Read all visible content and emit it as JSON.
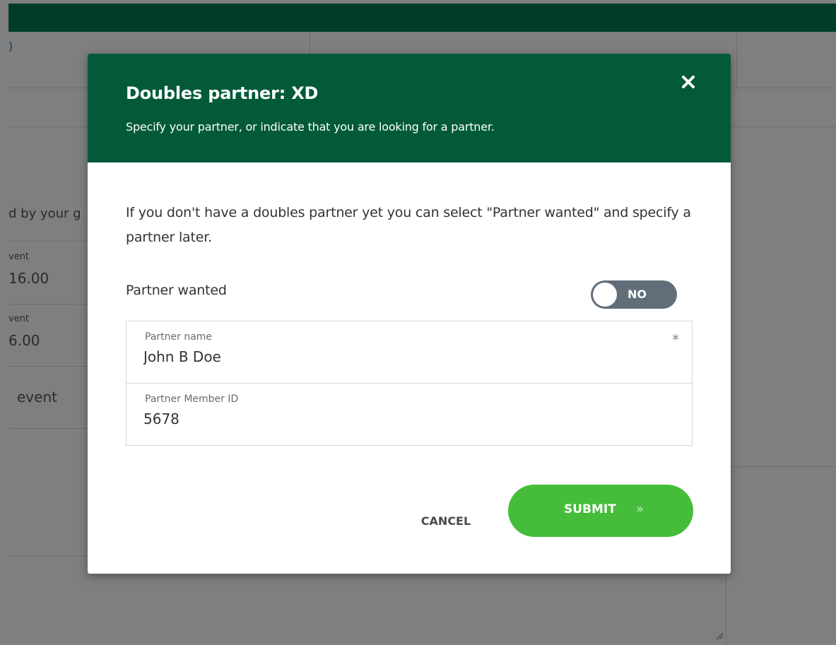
{
  "background": {
    "partial_text": "d by your g",
    "rows": [
      {
        "label": "vent",
        "value": "16.00"
      },
      {
        "label": "vent",
        "value": "6.00"
      }
    ],
    "event_text": "event"
  },
  "modal": {
    "title": "Doubles partner: XD",
    "subtitle": "Specify your partner, or indicate that you are looking for a partner.",
    "intro": "If you don't have a doubles partner yet you can select \"Partner wanted\" and specify a partner later.",
    "partner_wanted": {
      "label": "Partner wanted",
      "state": "NO"
    },
    "fields": {
      "partner_name": {
        "label": "Partner name",
        "value": "John B Doe",
        "required_mark": "*"
      },
      "partner_member_id": {
        "label": "Partner Member ID",
        "value": "5678"
      }
    },
    "buttons": {
      "cancel": "CANCEL",
      "submit": "SUBMIT",
      "submit_arrow": "»"
    }
  },
  "colors": {
    "header": "#025a39",
    "topbar": "#003d26",
    "toggle": "#616d78",
    "submit": "#45bd3a"
  },
  "icons": {
    "close": "close-icon",
    "submit_arrow": "double-chevron-right-icon",
    "resize": "resize-grip-icon"
  }
}
